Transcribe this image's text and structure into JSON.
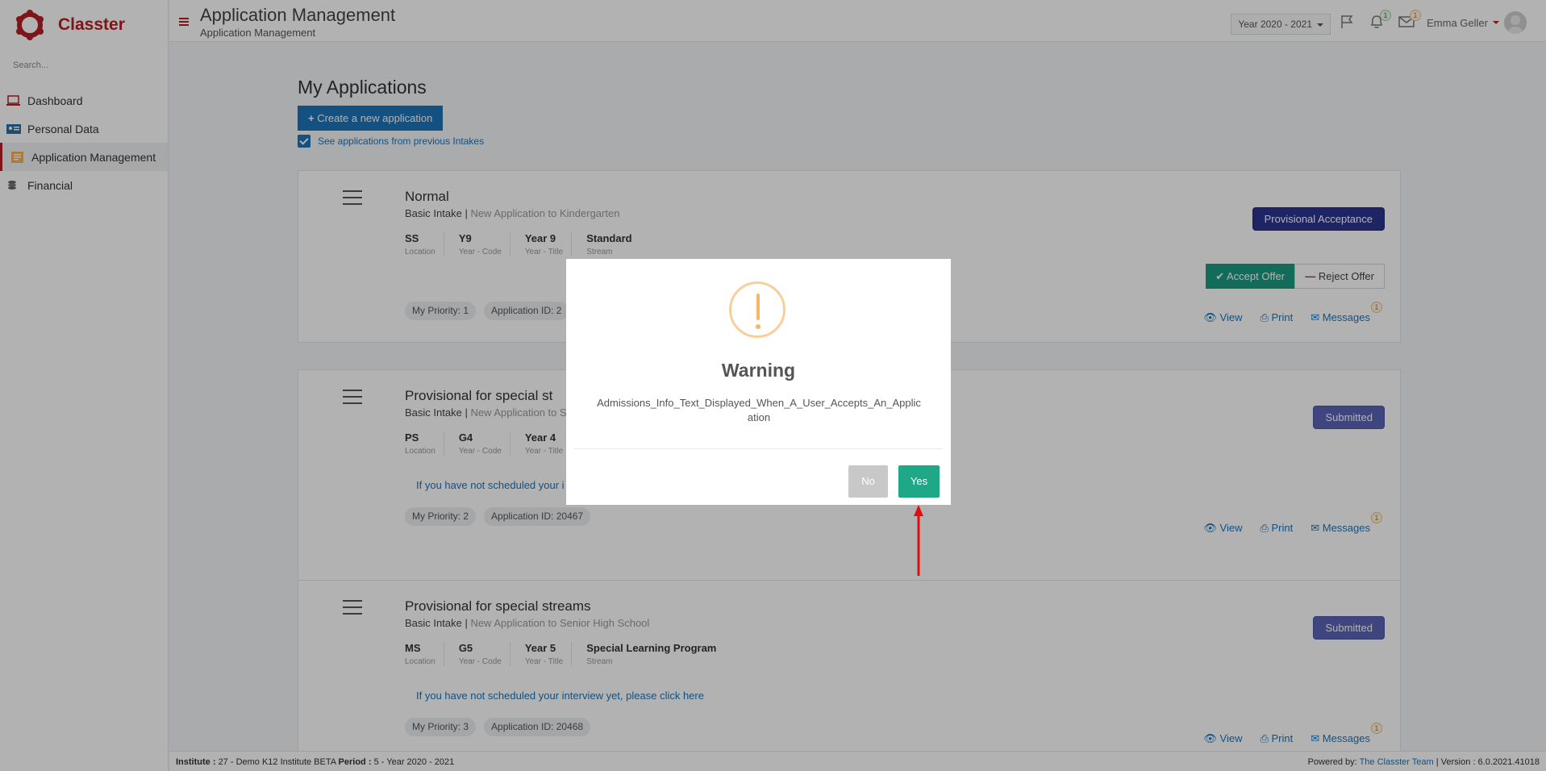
{
  "brand": {
    "name": "Classter",
    "accent": "#b52025"
  },
  "sidebar": {
    "search_placeholder": "Search...",
    "items": [
      {
        "label": "Dashboard",
        "icon": "laptop-icon"
      },
      {
        "label": "Personal Data",
        "icon": "id-card-icon"
      },
      {
        "label": "Application Management",
        "icon": "document-icon",
        "active": true
      },
      {
        "label": "Financial",
        "icon": "coins-icon"
      }
    ]
  },
  "header": {
    "title": "Application Management",
    "subtitle": "Application Management",
    "year": "Year 2020 - 2021",
    "notifications_count": "1",
    "messages_count": "1",
    "user": "Emma Geller"
  },
  "main": {
    "title": "My Applications",
    "create_button": "Create a new application",
    "previous_intakes_label": "See applications from previous Intakes",
    "labels": {
      "location": "Location",
      "year_code": "Year - Code",
      "year_title": "Year - Title",
      "stream": "Stream",
      "view": "View",
      "print": "Print",
      "messages": "Messages",
      "accept_offer": "Accept Offer",
      "reject_offer": "Reject Offer",
      "interview_link": "If you have not scheduled your interview yet, please click here"
    },
    "applications": [
      {
        "title": "Normal",
        "intake": "Basic Intake",
        "intake_desc": "New Application to Kindergarten",
        "location": "SS",
        "year_code": "Y9",
        "year_title": "Year 9",
        "stream": "Standard",
        "priority": "My Priority: 1",
        "app_id": "Application ID: 2",
        "status": "Provisional Acceptance",
        "messages_badge": "1"
      },
      {
        "title": "Provisional for special st",
        "intake": "Basic Intake",
        "intake_desc": "New Application to S",
        "location": "PS",
        "year_code": "G4",
        "year_title": "Year 4",
        "interview_partial": "If you have not scheduled your i",
        "priority": "My Priority: 2",
        "app_id": "Application ID: 20467",
        "status": "Submitted",
        "messages_badge": "1"
      },
      {
        "title": "Provisional for special streams",
        "intake": "Basic Intake",
        "intake_desc": "New Application to Senior High School",
        "location": "MS",
        "year_code": "G5",
        "year_title": "Year 5",
        "stream": "Special Learning Program",
        "priority": "My Priority: 3",
        "app_id": "Application ID: 20468",
        "status": "Submitted",
        "messages_badge": "1"
      }
    ]
  },
  "footer": {
    "institute_label": "Institute :",
    "institute_value": "27 - Demo K12 Institute BETA",
    "period_label": "Period :",
    "period_value": "5 - Year 2020 - 2021",
    "powered_label": "Powered by:",
    "powered_link": "The Classter Team",
    "version": "| Version : 6.0.2021.41018"
  },
  "modal": {
    "title": "Warning",
    "text": "Admissions_Info_Text_Displayed_When_A_User_Accepts_An_Application",
    "no_label": "No",
    "yes_label": "Yes"
  }
}
